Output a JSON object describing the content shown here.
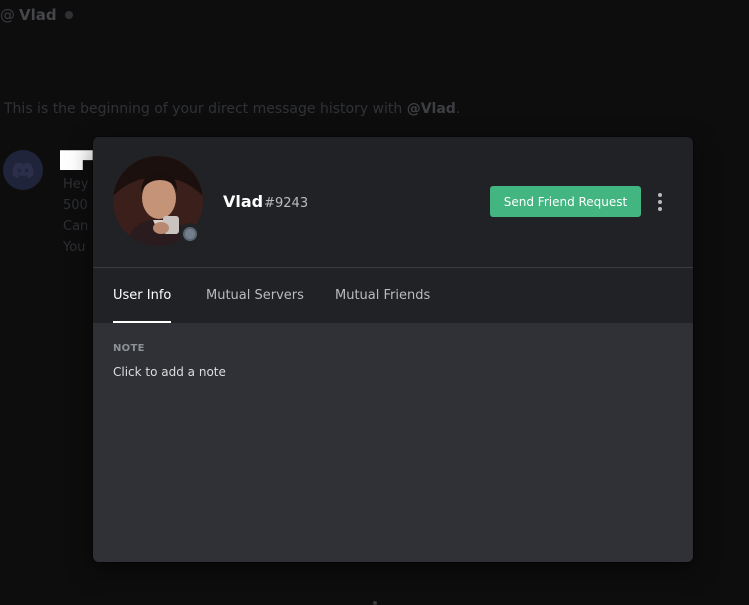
{
  "dm": {
    "at_symbol": "@",
    "name": "Vlad",
    "intro_prefix": "This is the beginning of your direct message history with ",
    "intro_user": "@Vlad",
    "intro_suffix": ".",
    "message_lines": [
      "Hey",
      "500",
      "Can",
      "You"
    ]
  },
  "profile": {
    "username": "Vlad",
    "discriminator": "#9243",
    "status": "offline",
    "send_friend_request_label": "Send Friend Request",
    "more_icon": "vertical-ellipsis"
  },
  "tabs": [
    {
      "label": "User Info",
      "active": true
    },
    {
      "label": "Mutual Servers",
      "active": false
    },
    {
      "label": "Mutual Friends",
      "active": false
    }
  ],
  "note": {
    "label": "NOTE",
    "placeholder": "Click to add a note"
  },
  "colors": {
    "accent_green": "#43b581",
    "modal_header": "#202225",
    "modal_body": "#2f3136",
    "offline_status": "#747f8d"
  }
}
